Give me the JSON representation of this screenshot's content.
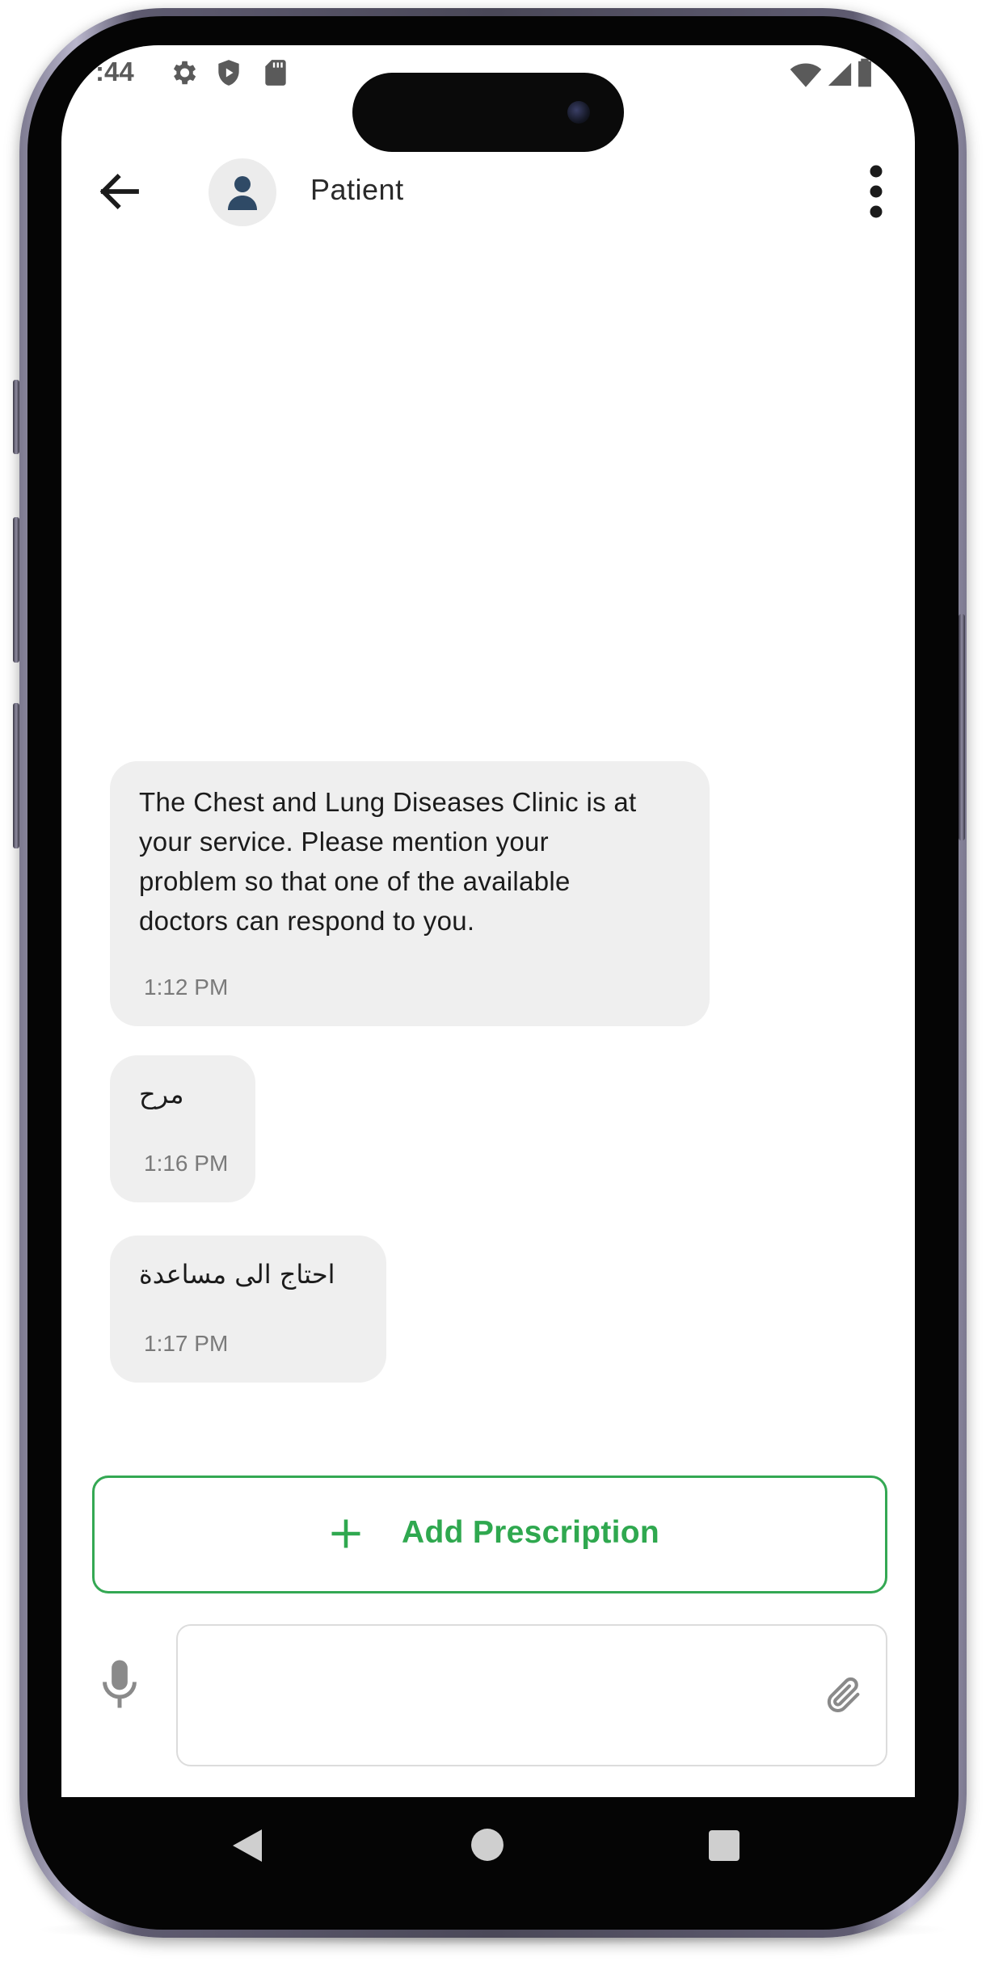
{
  "status_bar": {
    "time": ":44",
    "icons": [
      "gear-icon",
      "shield-play-icon",
      "sd-card-icon",
      "wifi-icon",
      "signal-icon",
      "battery-icon"
    ]
  },
  "header": {
    "contact_name": "Patient",
    "back_icon": "arrow-left-icon",
    "avatar_icon": "person-icon",
    "menu_icon": "more-vertical-icon"
  },
  "messages": [
    {
      "lines": [
        "The Chest and Lung Diseases Clinic is at",
        "your service. Please mention your",
        "problem so that one of the available",
        "doctors can respond to you."
      ],
      "time": "1:12 PM"
    },
    {
      "text": "مرح",
      "time": "1:16 PM"
    },
    {
      "text": "احتاج الى مساعدة",
      "time": "1:17 PM"
    }
  ],
  "actions": {
    "add_prescription_label": "Add Prescription",
    "add_prescription_icon": "plus-icon"
  },
  "composer": {
    "mic_icon": "microphone-icon",
    "input_value": "",
    "input_placeholder": "",
    "attach_icon": "paperclip-icon"
  },
  "nav": {
    "icons": [
      "back-triangle-icon",
      "home-circle-icon",
      "recents-square-icon"
    ]
  },
  "colors": {
    "accent": "#34a853",
    "bubble": "#efefef",
    "frame": "#4a4858"
  }
}
